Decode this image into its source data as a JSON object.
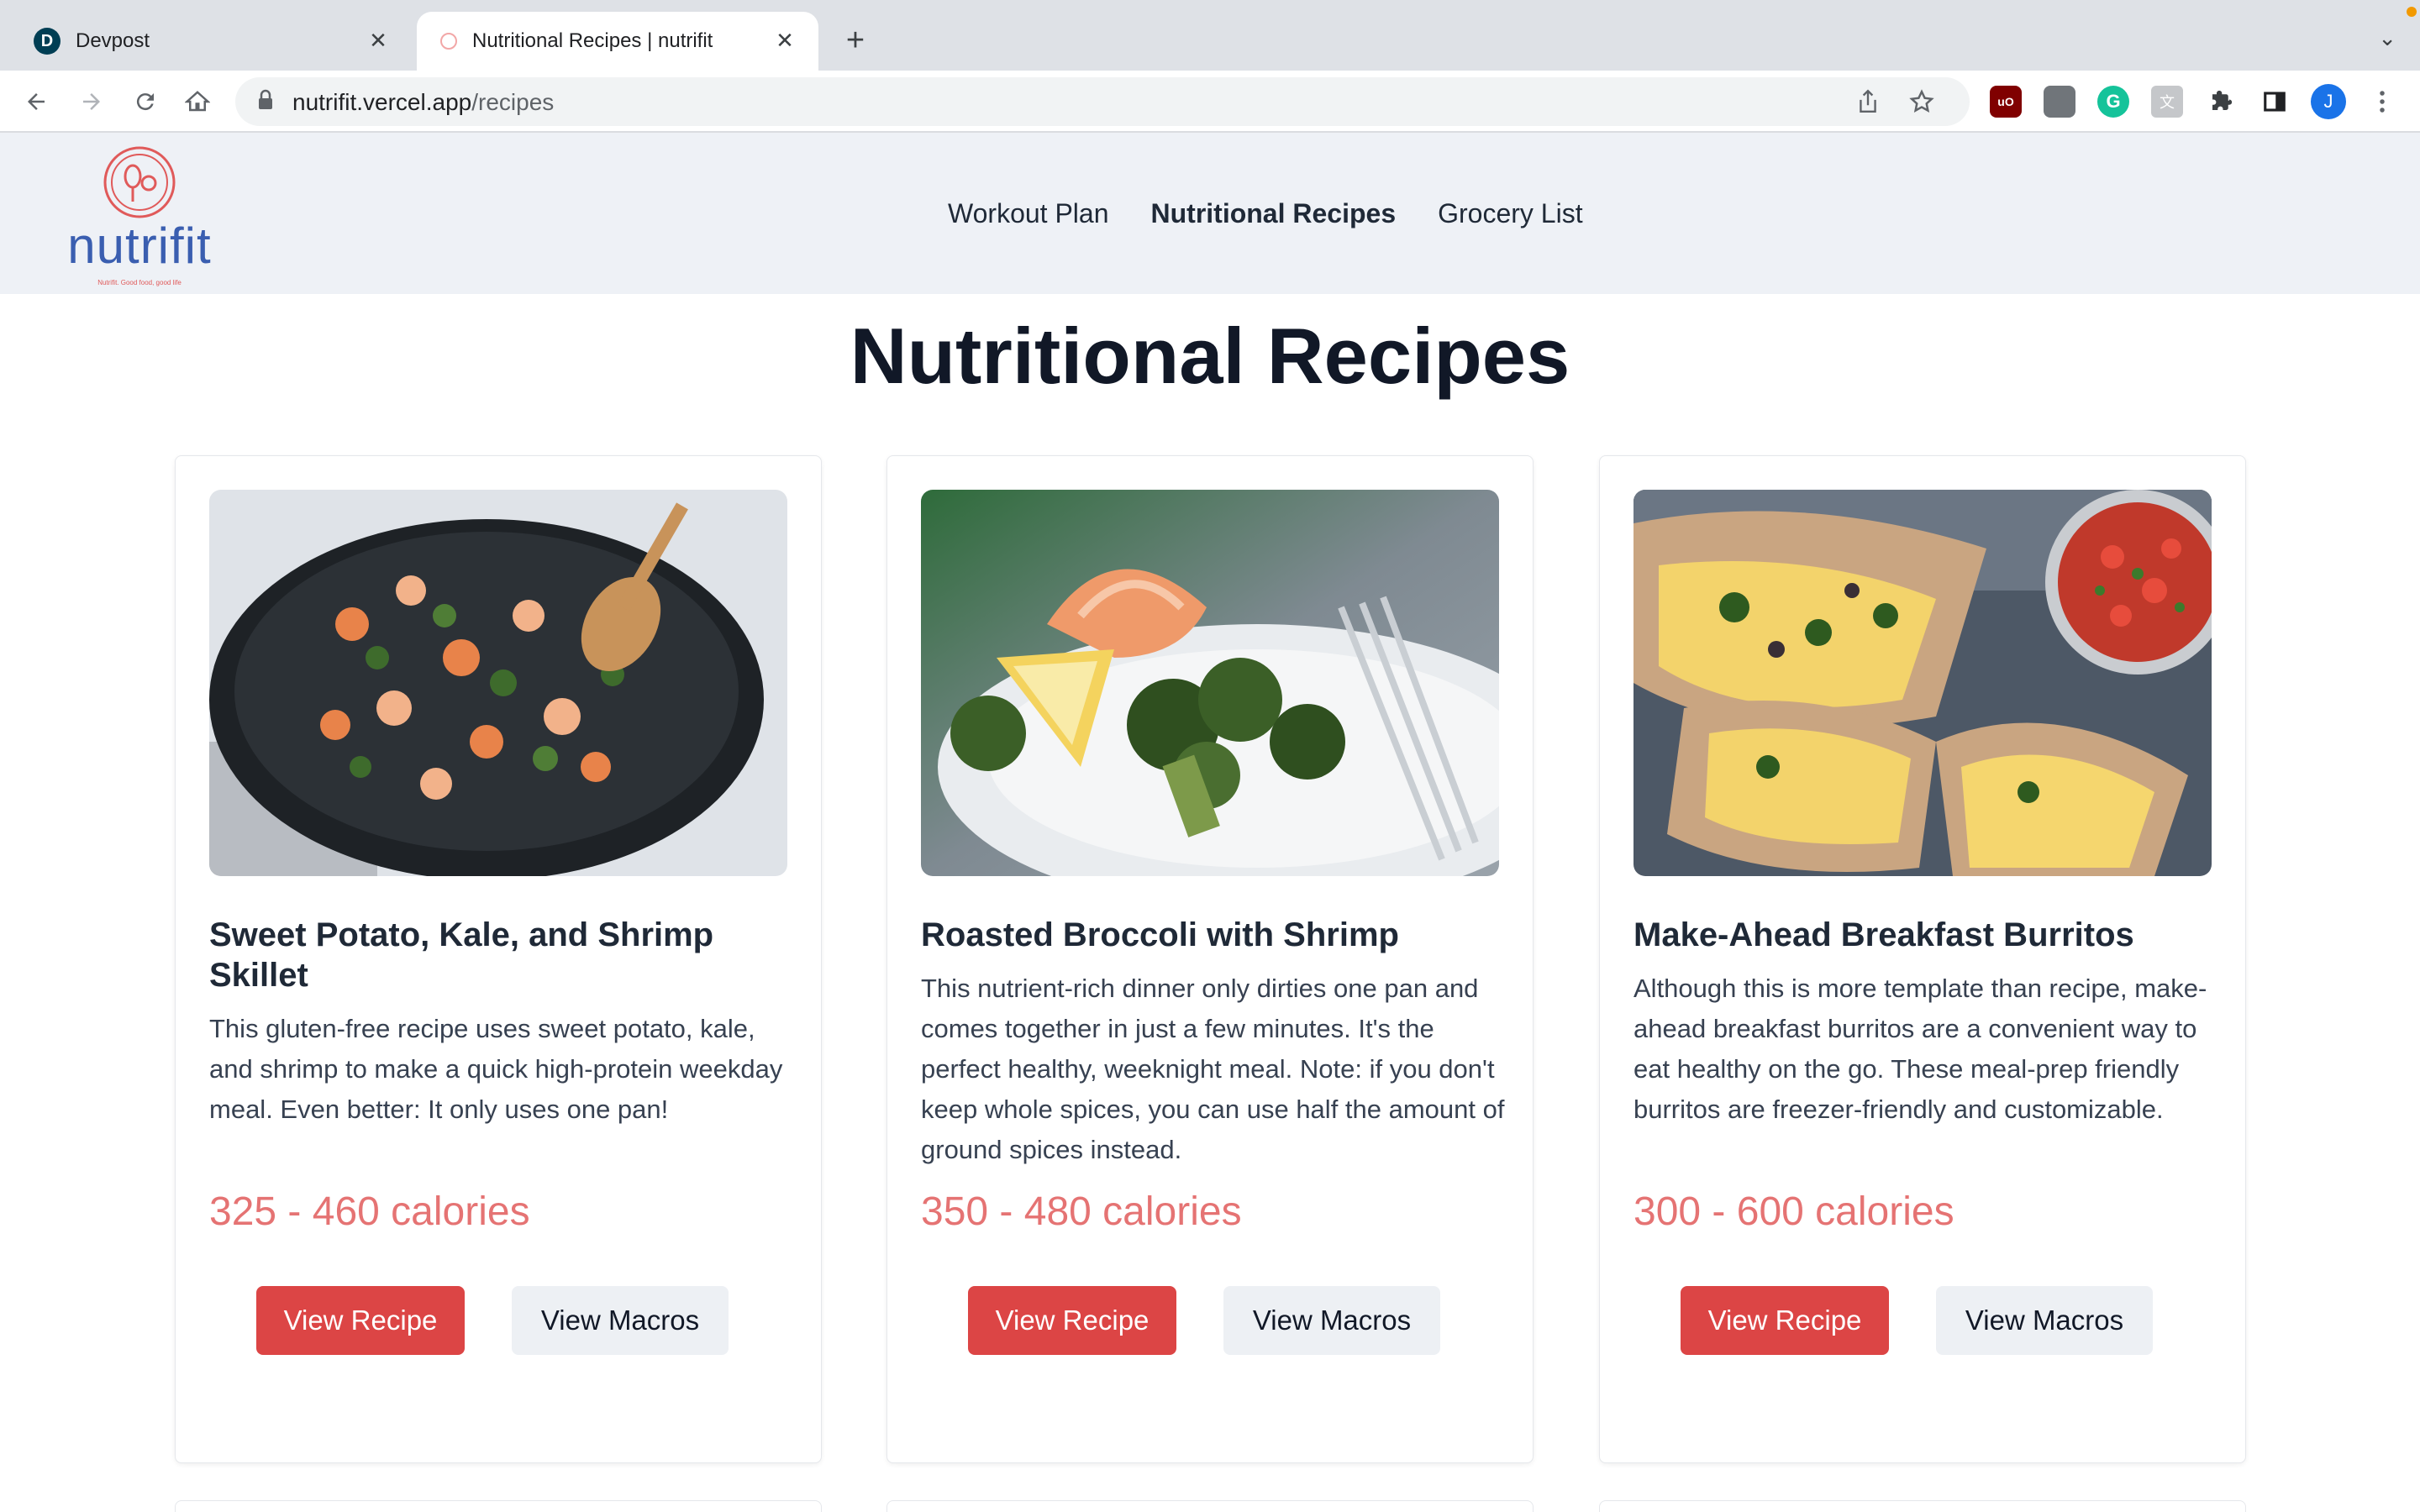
{
  "browser": {
    "tabs": [
      {
        "title": "Devpost",
        "favicon_letter": "D"
      },
      {
        "title": "Nutritional Recipes | nutrifit"
      }
    ],
    "url_host": "nutrifit.vercel.app",
    "url_path": "/recipes",
    "avatar_letter": "J",
    "grammarly_letter": "G",
    "ublock_label": "uO"
  },
  "site": {
    "logo_text": "nutrifit",
    "logo_tagline": "Nutrifit. Good food, good life",
    "nav": [
      {
        "label": "Workout Plan"
      },
      {
        "label": "Nutritional Recipes"
      },
      {
        "label": "Grocery List"
      }
    ]
  },
  "page": {
    "title": "Nutritional Recipes"
  },
  "recipes": [
    {
      "image": "shrimp-sweet-potato-kale-skillet",
      "title": "Sweet Potato, Kale, and Shrimp Skillet",
      "description": "This gluten-free recipe uses sweet potato, kale, and shrimp to make a quick high-protein weekday meal. Even better: It only uses one pan!",
      "calories": "325 - 460 calories",
      "view_recipe": "View Recipe",
      "view_macros": "View Macros"
    },
    {
      "image": "roasted-broccoli-shrimp-plate",
      "title": "Roasted Broccoli with Shrimp",
      "description": "This nutrient-rich dinner only dirties one pan and comes together in just a few minutes. It's the perfect healthy, weeknight meal. Note: if you don't keep whole spices, you can use half the amount of ground spices instead.",
      "calories": "350 - 480 calories",
      "view_recipe": "View Recipe",
      "view_macros": "View Macros"
    },
    {
      "image": "breakfast-burritos-with-salsa",
      "title": "Make-Ahead Breakfast Burritos",
      "description": "Although this is more template than recipe, make-ahead breakfast burritos are a convenient way to eat healthy on the go. These meal-prep friendly burritos are freezer-friendly and customizable.",
      "calories": "300 - 600 calories",
      "view_recipe": "View Recipe",
      "view_macros": "View Macros"
    }
  ],
  "colors": {
    "accent_red": "#dc4545",
    "calories_pink": "#e57373",
    "header_bg": "#eef1f6",
    "logo_blue": "#3a5eb0"
  }
}
